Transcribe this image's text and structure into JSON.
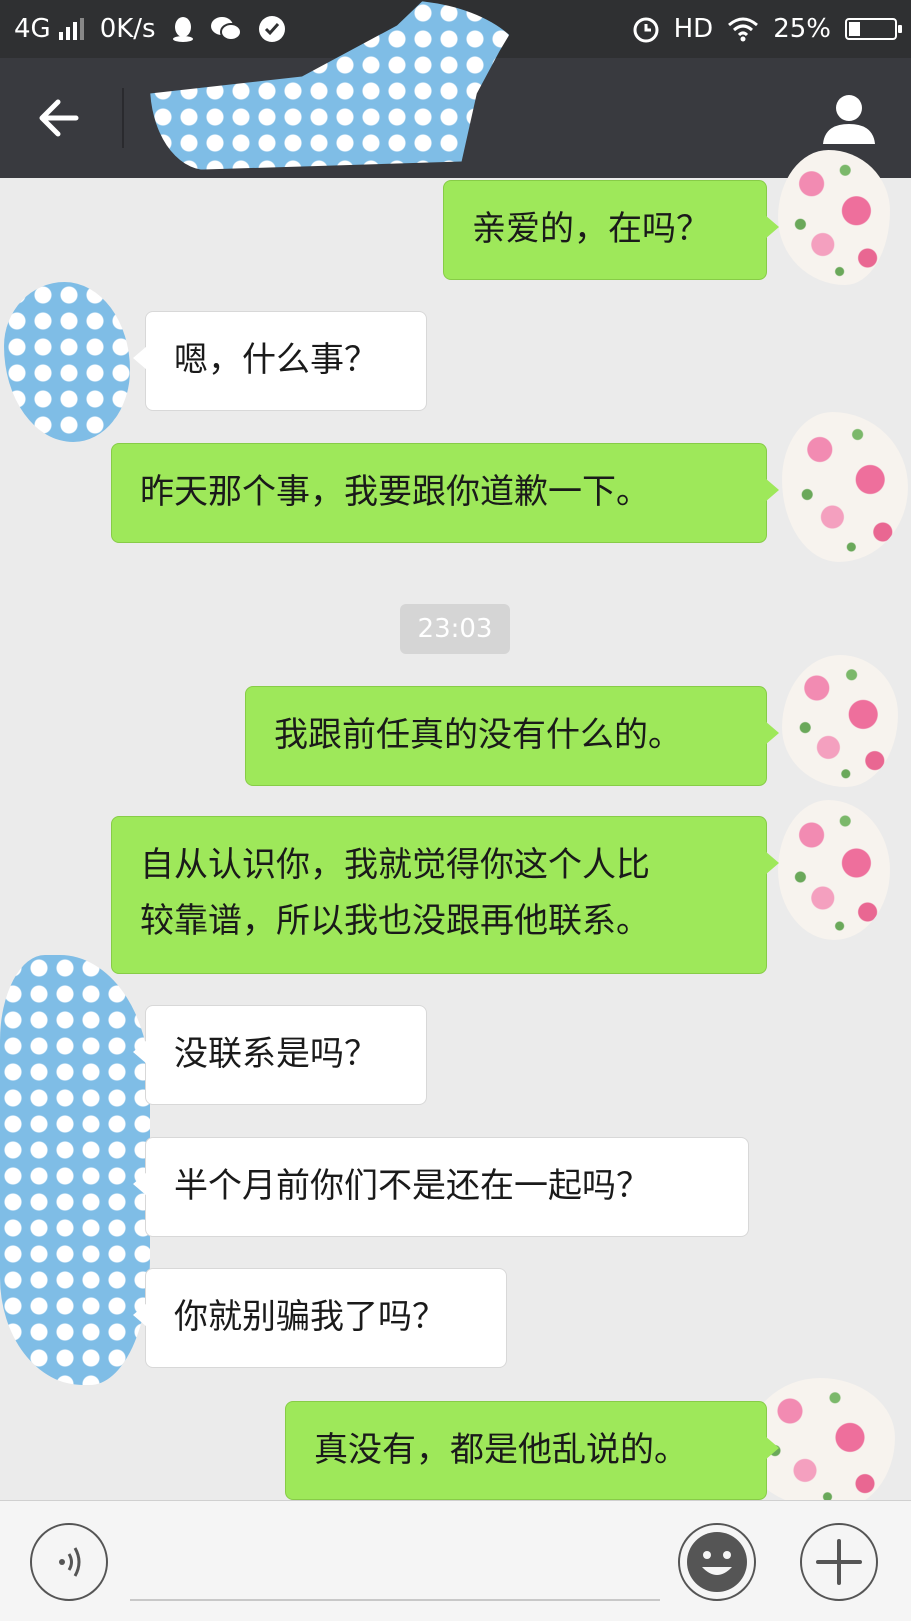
{
  "status_bar": {
    "network": "4G",
    "speed": "0K/s",
    "hd": "HD",
    "battery": "25%",
    "battery_level": 0.25
  },
  "header": {
    "back_icon": "arrow-left-icon",
    "profile_icon": "person-icon"
  },
  "messages": [
    {
      "from": "me",
      "text": "亲爱的，在吗？"
    },
    {
      "from": "them",
      "text": "嗯，什么事？"
    },
    {
      "from": "me",
      "text": "昨天那个事，我要跟你道歉一下。"
    },
    {
      "from": "me",
      "text": "我跟前任真的没有什么的。"
    },
    {
      "from": "me",
      "text": "自从认识你，我就觉得你这个人比\n较靠谱，所以我也没跟再他联系。"
    },
    {
      "from": "them",
      "text": "没联系是吗？"
    },
    {
      "from": "them",
      "text": "半个月前你们不是还在一起吗？"
    },
    {
      "from": "them",
      "text": "你就别骗我了吗？"
    },
    {
      "from": "me",
      "text": "真没有，都是他乱说的。"
    }
  ],
  "timestamp": "23:03",
  "input_bar": {
    "voice_icon": "voice-icon",
    "emoji_icon": "emoji-icon",
    "plus_icon": "plus-icon"
  },
  "colors": {
    "my_bubble": "#9ee85a",
    "their_bubble": "#ffffff",
    "title_bar": "#393a3f"
  }
}
